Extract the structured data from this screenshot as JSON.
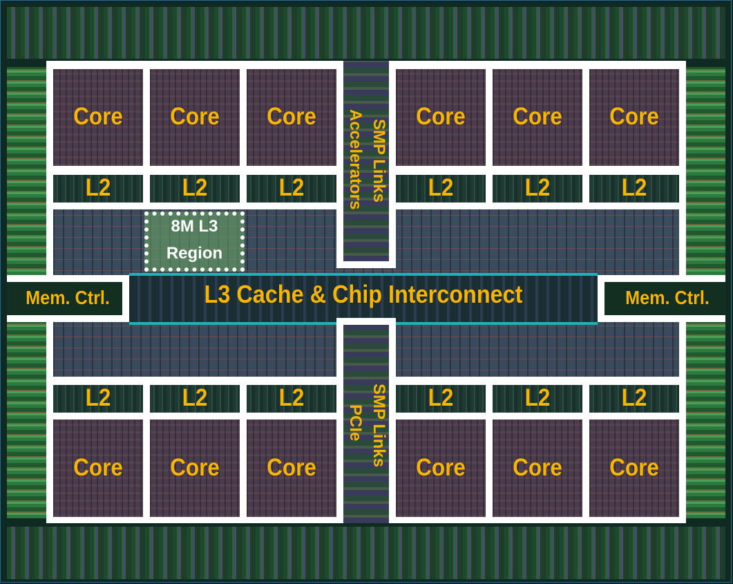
{
  "labels": {
    "core": "Core",
    "l2": "L2",
    "l3_region_line1": "8M L3",
    "l3_region_line2": "Region",
    "interconnect": "L3 Cache & Chip Interconnect",
    "mem_ctrl_left": "Mem. Ctrl.",
    "mem_ctrl_right": "Mem. Ctrl.",
    "smp_top_1": "SMP Links",
    "smp_top_2": "Accelerators",
    "smp_bottom_1": "SMP Links",
    "smp_bottom_2": "PCIe"
  },
  "colors": {
    "label": "#f7b500",
    "divider": "#ffffff"
  }
}
